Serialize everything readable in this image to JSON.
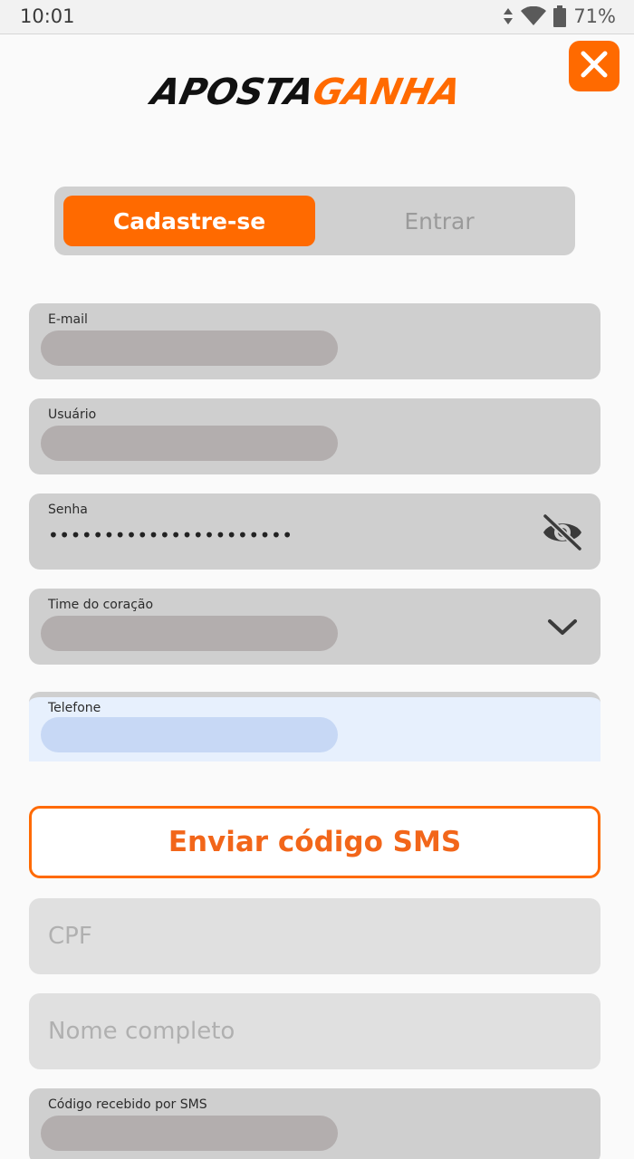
{
  "status_bar": {
    "time": "10:01",
    "battery": "71%"
  },
  "icons": {
    "close": "close-icon",
    "eye_off": "eye-off-icon",
    "chevron": "chevron-down-icon",
    "wifi": "wifi-icon",
    "battery": "battery-icon",
    "data": "data-arrows-icon"
  },
  "brand": {
    "part1": "APOSTA",
    "part2": "GANHA",
    "accent_color": "#ff6a00"
  },
  "tabs": {
    "signup": "Cadastre-se",
    "login": "Entrar"
  },
  "form": {
    "email_label": "E-mail",
    "user_label": "Usuário",
    "password_label": "Senha",
    "password_value": "••••••••••••••••••••••",
    "team_label": "Time do coração",
    "phone_label": "Telefone",
    "sms_button": "Enviar código SMS",
    "cpf_placeholder": "CPF",
    "name_placeholder": "Nome completo",
    "sms_code_label": "Código recebido por SMS"
  }
}
